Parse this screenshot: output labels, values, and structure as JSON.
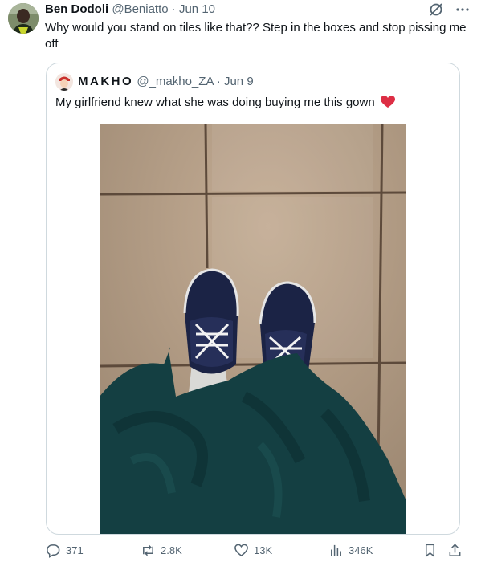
{
  "tweet": {
    "author_name": "Ben Dodoli",
    "author_handle": "@Beniatto",
    "date": "Jun 10",
    "text": "Why would you stand on tiles like that?? Step in the boxes and stop pissing me off",
    "more_icon": "more-dots-icon",
    "grok_icon": "grok-icon"
  },
  "quote": {
    "author_name": "MAKHO",
    "author_handle": "@_makho_ZA",
    "date": "Jun 9",
    "text": "My girlfriend knew what she was doing buying me this gown",
    "emoji": "red-heart-icon"
  },
  "actions": {
    "replies": "371",
    "reposts": "2.8K",
    "likes": "13K",
    "views": "346K"
  },
  "colors": {
    "text": "#0f1419",
    "muted": "#536471",
    "border": "#cfd9de",
    "heart": "#f91880"
  }
}
